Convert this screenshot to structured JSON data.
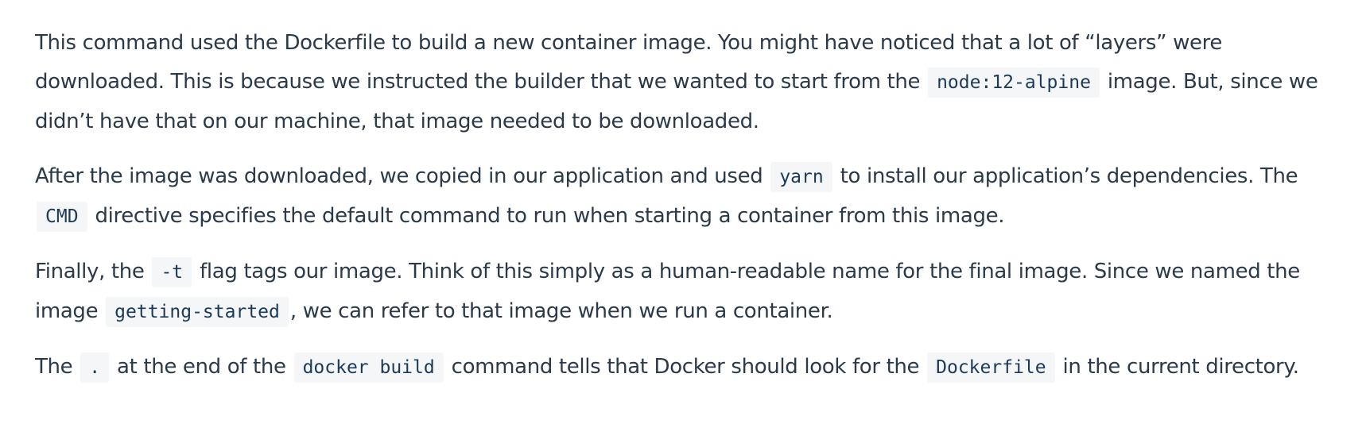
{
  "paragraphs": [
    {
      "p1_t1": "This command used the Dockerfile to build a new container image. You might have noticed that a lot of “layers” were downloaded. This is because we instructed the builder that we wanted to start from the",
      "p1_c1": "node:12-alpine",
      "p1_t2": "image. But, since we didn’t have that on our machine, that image needed to be downloaded."
    },
    {
      "p2_t1": "After the image was downloaded, we copied in our application and used",
      "p2_c1": "yarn",
      "p2_t2": "to install our application’s dependencies. The",
      "p2_c2": "CMD",
      "p2_t3": "directive specifies the default command to run when starting a container from this image."
    },
    {
      "p3_t1": "Finally, the",
      "p3_c1": "-t",
      "p3_t2": "flag tags our image. Think of this simply as a human-readable name for the final image. Since we named the image",
      "p3_c2": "getting-started",
      "p3_t3": ", we can refer to that image when we run a container."
    },
    {
      "p4_t1": "The",
      "p4_c1": ".",
      "p4_t2": "at the end of the",
      "p4_c2": "docker build",
      "p4_t3": "command tells that Docker should look for the",
      "p4_c3": "Dockerfile",
      "p4_t4": "in the current directory."
    }
  ]
}
